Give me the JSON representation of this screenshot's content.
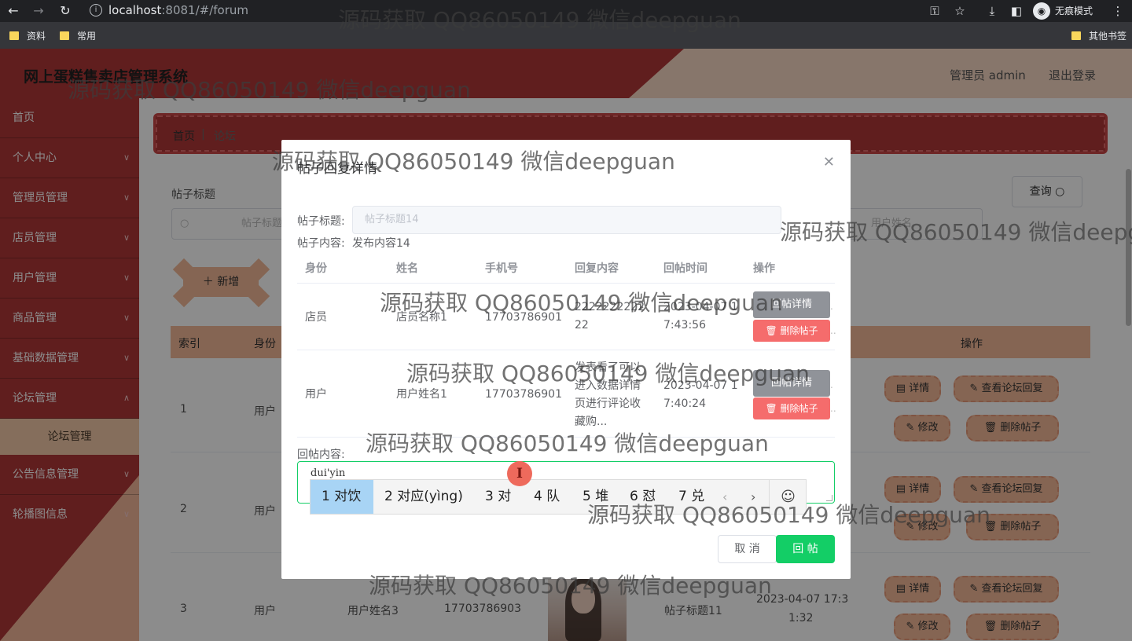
{
  "browser": {
    "url_host": "localhost",
    "url_path": ":8081/#/forum",
    "incognito_label": "无痕模式",
    "bookmarks": [
      "资料",
      "常用"
    ],
    "other_bookmarks": "其他书签"
  },
  "header": {
    "title": "网上蛋糕售卖店管理系统",
    "user": "管理员 admin",
    "logout": "退出登录"
  },
  "sidebar": {
    "items": [
      "首页",
      "个人中心",
      "管理员管理",
      "店员管理",
      "用户管理",
      "商品管理",
      "基础数据管理",
      "论坛管理"
    ],
    "sub_item": "论坛管理",
    "items_after": [
      "公告信息管理",
      "轮播图信息"
    ]
  },
  "breadcrumb": {
    "home": "首页",
    "sep": "|",
    "current": "论坛"
  },
  "filters": {
    "title_label": "帖子标题",
    "title_placeholder": "帖子标题",
    "other_placeholder": "用户姓名",
    "query": "查询"
  },
  "actions": {
    "add": "新增"
  },
  "table": {
    "headers": {
      "index": "索引",
      "role": "身份",
      "ops": "操作"
    },
    "rows": [
      {
        "index": "1",
        "role": "用户"
      },
      {
        "index": "2",
        "role": "用户"
      },
      {
        "index": "3",
        "role": "用户",
        "name": "用户姓名3",
        "phone": "17703786903",
        "title": "帖子标题11",
        "time_l1": "2023-04-07 17:3",
        "time_l2": "1:32"
      }
    ],
    "btn_detail": "详情",
    "btn_view_replies": "查看论坛回复",
    "btn_edit": "修改",
    "btn_delete": "删除帖子"
  },
  "dialog": {
    "title": "帖子回复详情",
    "post_title_label": "帖子标题:",
    "post_title_value": "帖子标题14",
    "post_content_label": "帖子内容:",
    "post_content_value": "发布内容14",
    "columns": [
      "身份",
      "姓名",
      "手机号",
      "回复内容",
      "回帖时间",
      "操作"
    ],
    "replies": [
      {
        "role": "店员",
        "name": "店员名称1",
        "phone": "17703786901",
        "content_l1": "2222222222",
        "content_l2": "22",
        "time_l1": "2023-04-07 1",
        "time_l2": "7:43:56"
      },
      {
        "role": "用户",
        "name": "用户姓名1",
        "phone": "17703786901",
        "content_l1": "发表看了可以",
        "content_l2": "进入数据详情",
        "content_l3": "页进行评论收",
        "content_l4": "藏购...",
        "time_l1": "2023-04-07 1",
        "time_l2": "7:40:24"
      }
    ],
    "btn_reply_detail": "回帖详情",
    "btn_delete_post": "删除帖子",
    "reply_label": "回帖内容:",
    "reply_typed": "dui'yin",
    "cancel": "取 消",
    "submit": "回 帖"
  },
  "ime": {
    "candidates": [
      "1 对饮",
      "2 对应(yìng)",
      "3 对",
      "4 队",
      "5 堆",
      "6 怼",
      "7 兑"
    ]
  },
  "watermark": "源码获取 QQ86050149 微信deepguan"
}
